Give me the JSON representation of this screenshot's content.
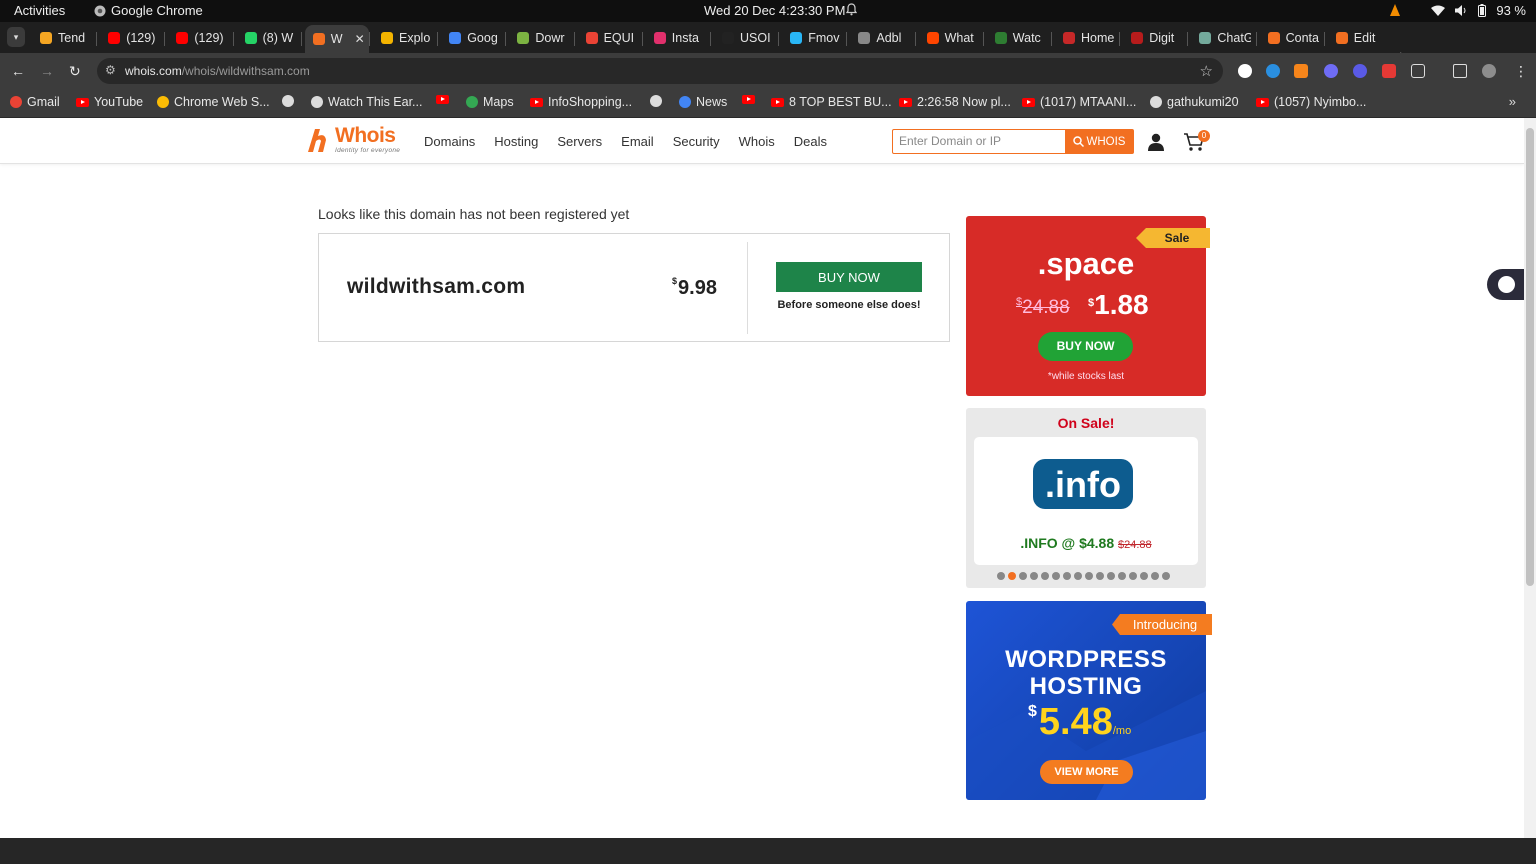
{
  "system": {
    "activities": "Activities",
    "app_name": "Google Chrome",
    "clock": "Wed 20 Dec  4:23:30 PM",
    "battery": "93 %"
  },
  "tabs": [
    {
      "label": "Tend",
      "color": "#f5a623"
    },
    {
      "label": "(129)",
      "color": "#ff0000"
    },
    {
      "label": "(129)",
      "color": "#ff0000"
    },
    {
      "label": "(8) W",
      "color": "#25d366"
    },
    {
      "label": "W",
      "color": "#f26f21",
      "active": true
    },
    {
      "label": "Explo",
      "color": "#f4b400"
    },
    {
      "label": "Goog",
      "color": "#4285f4"
    },
    {
      "label": "Dowr",
      "color": "#7cb342"
    },
    {
      "label": "EQUI",
      "color": "#ea4335"
    },
    {
      "label": "Insta",
      "color": "#e1306c"
    },
    {
      "label": "USOI",
      "color": "#222222"
    },
    {
      "label": "Fmov",
      "color": "#29b6f6"
    },
    {
      "label": "Adbl",
      "color": "#888888"
    },
    {
      "label": "What",
      "color": "#ff4500"
    },
    {
      "label": "Watc",
      "color": "#2e7d32"
    },
    {
      "label": "Home",
      "color": "#c62828"
    },
    {
      "label": "Digit",
      "color": "#b71c1c"
    },
    {
      "label": "ChatG",
      "color": "#74aa9c"
    },
    {
      "label": "Conta",
      "color": "#f26f21"
    },
    {
      "label": "Edit",
      "color": "#f26f21"
    }
  ],
  "toolbar": {
    "url_host": "whois.com",
    "url_path": "/whois/wildwithsam.com"
  },
  "bookmarks": [
    {
      "label": "Gmail",
      "type": "google"
    },
    {
      "label": "YouTube",
      "type": "yt"
    },
    {
      "label": "Chrome Web S...",
      "type": "store"
    },
    {
      "label": "",
      "type": "globe"
    },
    {
      "label": "Watch This Ear...",
      "type": "globe"
    },
    {
      "label": "",
      "type": "yt"
    },
    {
      "label": "Maps",
      "type": "maps"
    },
    {
      "label": "InfoShopping...",
      "type": "yt"
    },
    {
      "label": "",
      "type": "globe"
    },
    {
      "label": "News",
      "type": "news"
    },
    {
      "label": "",
      "type": "yt"
    },
    {
      "label": "8 TOP BEST BU...",
      "type": "yt"
    },
    {
      "label": "2:26:58 Now pl...",
      "type": "yt"
    },
    {
      "label": "(1017) MTAANI...",
      "type": "yt"
    },
    {
      "label": "gathukumi20",
      "type": "globe"
    },
    {
      "label": "(1057) Nyimbo...",
      "type": "yt"
    }
  ],
  "site": {
    "logo_word": "Whois",
    "logo_tagline": "Identity for everyone",
    "nav": [
      "Domains",
      "Hosting",
      "Servers",
      "Email",
      "Security",
      "Whois",
      "Deals"
    ],
    "search_placeholder": "Enter Domain or IP",
    "search_button": "WHOIS",
    "cart_count": "0"
  },
  "result": {
    "message": "Looks like this domain has not been registered yet",
    "domain": "wildwithsam.com",
    "currency": "$",
    "price": "9.98",
    "buy_label": "BUY NOW",
    "hint": "Before someone else does!"
  },
  "promo_space": {
    "ribbon": "Sale",
    "tld": ".space",
    "currency": "$",
    "old_price": "24.88",
    "new_price": "1.88",
    "button": "BUY NOW",
    "note": "*while stocks last"
  },
  "promo_info": {
    "title": "On Sale!",
    "logo_text": ".info",
    "offer": ".INFO @ $4.88",
    "offer_strike": "$24.88",
    "slide_count": 16,
    "active_slide": 1
  },
  "promo_wp": {
    "ribbon": "Introducing",
    "line1": "WORDPRESS",
    "line2": "HOSTING",
    "currency": "$",
    "price": "5.48",
    "per": "/mo",
    "button": "VIEW MORE"
  }
}
